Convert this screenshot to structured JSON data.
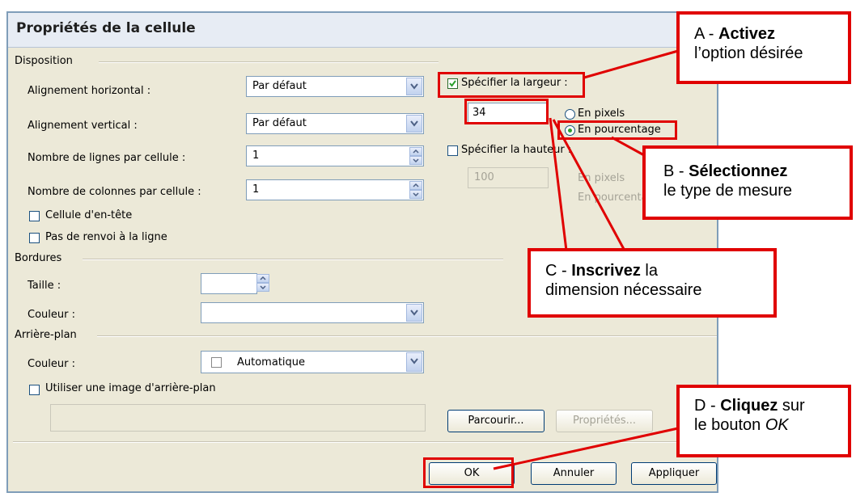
{
  "dialog": {
    "title": "Propriétés de la cellule",
    "disposition": {
      "legend": "Disposition",
      "h_align_label": "Alignement horizontal :",
      "h_align_value": "Par défaut",
      "v_align_label": "Alignement vertical :",
      "v_align_value": "Par défaut",
      "rows_label": "Nombre de lignes par cellule :",
      "rows_value": "1",
      "cols_label": "Nombre de colonnes par cellule :",
      "cols_value": "1",
      "header_cell_label": "Cellule d'en-tête",
      "nowrap_label": "Pas de renvoi à la ligne",
      "width_check_label": "Spécifier la largeur :",
      "width_value": "34",
      "in_pixels_label": "En pixels",
      "in_percent_label": "En pourcentage",
      "height_check_label": "Spécifier la hauteur :",
      "height_value": "100",
      "height_pixels_label": "En pixels",
      "height_percent_label": "En pourcentage"
    },
    "bordures": {
      "legend": "Bordures",
      "size_label": "Taille :",
      "size_value": "",
      "color_label": "Couleur :",
      "color_value": ""
    },
    "arriere_plan": {
      "legend": "Arrière-plan",
      "color_label": "Couleur :",
      "color_value": "Automatique",
      "use_image_label": "Utiliser une image d'arrière-plan",
      "image_path": "",
      "browse_label": "Parcourir...",
      "properties_label": "Propriétés..."
    },
    "buttons": {
      "ok": "OK",
      "cancel": "Annuler",
      "apply": "Appliquer"
    }
  },
  "callouts": {
    "a": {
      "prefix": "A - ",
      "bold": "Activez",
      "rest": "l’option désirée"
    },
    "b": {
      "prefix": "B - ",
      "bold": "Sélectionnez",
      "rest": "le type de mesure"
    },
    "c": {
      "prefix": "C - ",
      "bold": "Inscrivez",
      "suffix": " la",
      "rest": "dimension nécessaire"
    },
    "d": {
      "prefix": "D - ",
      "bold": "Cliquez",
      "suffix": " sur",
      "rest1": "le bouton ",
      "rest_italic": "OK"
    }
  },
  "colors": {
    "highlight": "#e00000",
    "dialog_bg": "#ece9d8",
    "check_green": "#2ca02c"
  },
  "icons": [
    "dropdown-arrow-icon",
    "spin-up-icon",
    "spin-down-icon",
    "check-icon"
  ]
}
